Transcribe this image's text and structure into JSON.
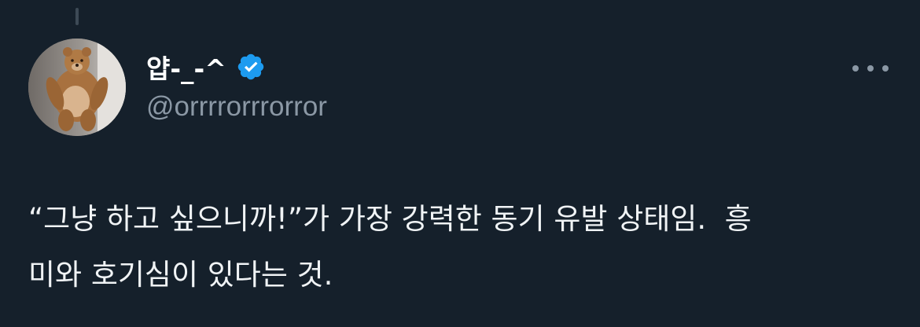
{
  "tweet": {
    "author": {
      "display_name": "얍-_-^",
      "handle": "@orrrrorrrorror",
      "verified": true,
      "avatar_icon": "teddy-bear-avatar"
    },
    "text": "“그냥 하고 싶으니까!”가 가장 강력한 동기 유발 상태임.  흥\n미와 호기심이 있다는 것.",
    "more_icon": "more-options-icon"
  },
  "colors": {
    "background": "#15202b",
    "text": "#ffffff",
    "secondary_text": "#8b98a5",
    "verified_badge": "#1d9bf0"
  }
}
